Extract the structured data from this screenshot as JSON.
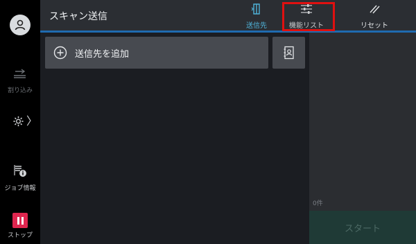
{
  "sidebar": {
    "interrupt_label": "割り込み",
    "job_info_label": "ジョブ情報",
    "stop_label": "ストップ",
    "settings_chevron": "〉"
  },
  "header": {
    "title": "スキャン送信",
    "tabs": [
      {
        "label": "送信先",
        "icon": "destination-icon"
      },
      {
        "label": "機能リスト",
        "icon": "sliders-icon"
      },
      {
        "label": "リセット",
        "icon": "reset-icon"
      }
    ]
  },
  "main": {
    "add_destination_label": "送信先を追加"
  },
  "panel": {
    "count": "0件",
    "start_label": "スタート"
  },
  "colors": {
    "accent": "#4fb3d9",
    "stop": "#e0264f",
    "highlight": "#e01010",
    "start_bg": "#1f3a36"
  }
}
